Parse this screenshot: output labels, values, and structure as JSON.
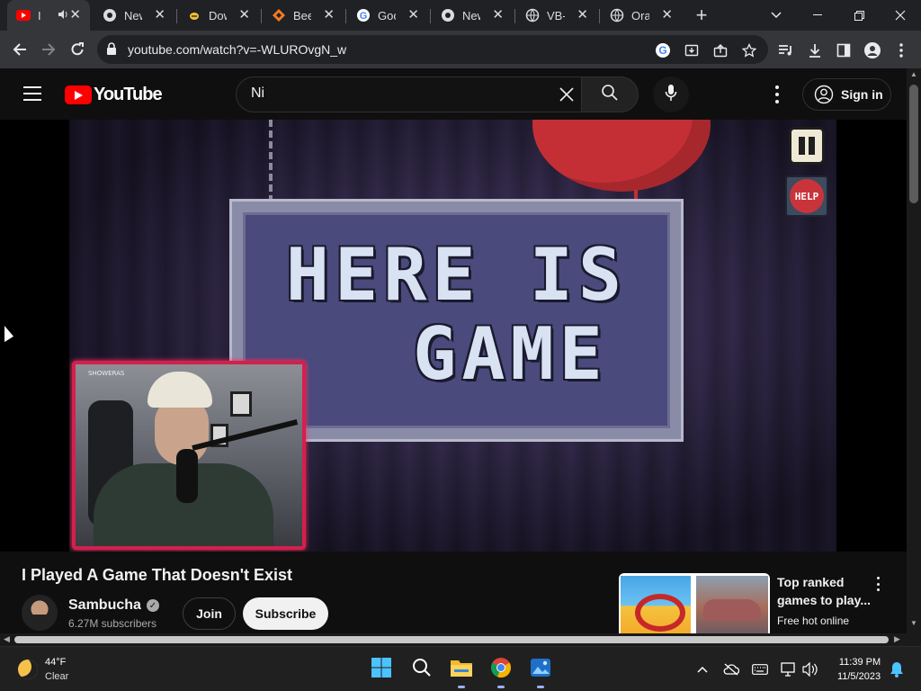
{
  "browser": {
    "tabs": [
      {
        "title": "I",
        "icon": "youtube-icon",
        "active": true
      },
      {
        "title": "New",
        "icon": "chrome-icon"
      },
      {
        "title": "Dow",
        "icon": "bee-icon"
      },
      {
        "title": "BeeB",
        "icon": "beebom-icon"
      },
      {
        "title": "Goo",
        "icon": "google-icon"
      },
      {
        "title": "New",
        "icon": "chrome-icon"
      },
      {
        "title": "VB-A",
        "icon": "globe-icon"
      },
      {
        "title": "Oran",
        "icon": "globe-icon"
      }
    ],
    "url": "youtube.com/watch?v=-WLUROvgN_w"
  },
  "youtube": {
    "logo_text": "YouTube",
    "search_value": "Ni",
    "signin_label": "Sign in"
  },
  "video": {
    "sign_line1": "HERE IS",
    "sign_line2": "GAME",
    "help_label": "HELP",
    "webcam_tag": "SHOWERAS"
  },
  "details": {
    "title": "I Played A Game That Doesn't Exist",
    "channel": "Sambucha",
    "subscribers": "6.27M subscribers",
    "join_label": "Join",
    "subscribe_label": "Subscribe",
    "ad_title": "Top ranked games to play...",
    "ad_source": "Free hot online"
  },
  "taskbar": {
    "temp": "44°F",
    "condition": "Clear",
    "time": "11:39 PM",
    "date": "11/5/2023"
  }
}
